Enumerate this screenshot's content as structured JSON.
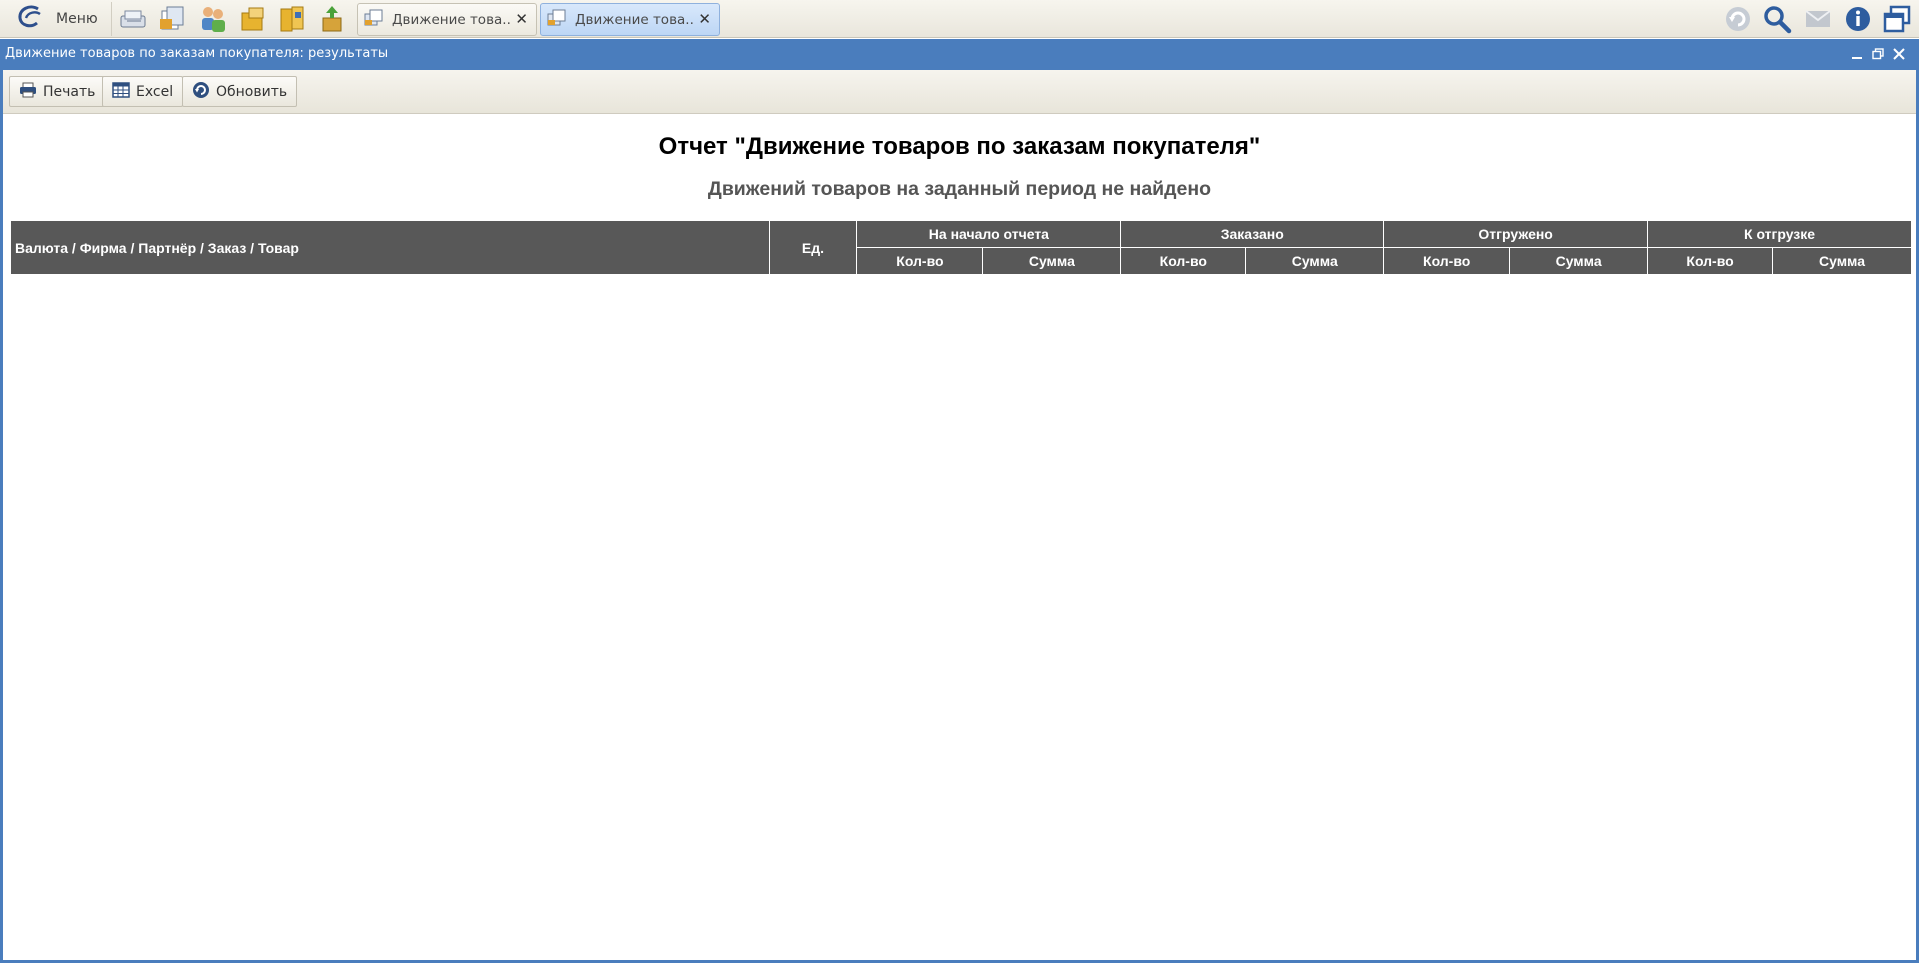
{
  "topbar": {
    "menu_label": "Меню",
    "quick_icons": [
      "calculator-book-icon",
      "documents-icon",
      "users-icon",
      "folder-icon",
      "clipboard-icon",
      "box-upload-icon"
    ],
    "tabs": [
      {
        "title": "Движение това...",
        "close": "✕",
        "active": false
      },
      {
        "title": "Движение това...",
        "close": "✕",
        "active": true
      }
    ],
    "right_icons": [
      "refresh-icon",
      "search-icon",
      "mail-icon",
      "info-icon",
      "windows-icon"
    ]
  },
  "window": {
    "title": "Движение товаров по заказам покупателя: результаты"
  },
  "toolbar": {
    "print_label": "Печать",
    "excel_label": "Excel",
    "refresh_label": "Обновить"
  },
  "report": {
    "title": "Отчет \"Движение товаров по заказам покупателя\"",
    "empty_message": "Движений товаров на заданный период не найдено",
    "columns": {
      "group": "Валюта / Фирма / Партнёр / Заказ / Товар",
      "unit": "Ед.",
      "sections": [
        {
          "label": "На начало отчета",
          "qty": "Кол-во",
          "sum": "Сумма"
        },
        {
          "label": "Заказано",
          "qty": "Кол-во",
          "sum": "Сумма"
        },
        {
          "label": "Отгружено",
          "qty": "Кол-во",
          "sum": "Сумма"
        },
        {
          "label": "К отгрузке",
          "qty": "Кол-во",
          "sum": "Сумма"
        }
      ]
    }
  },
  "colors": {
    "accent": "#4a7dbd",
    "table_header": "#585858"
  }
}
